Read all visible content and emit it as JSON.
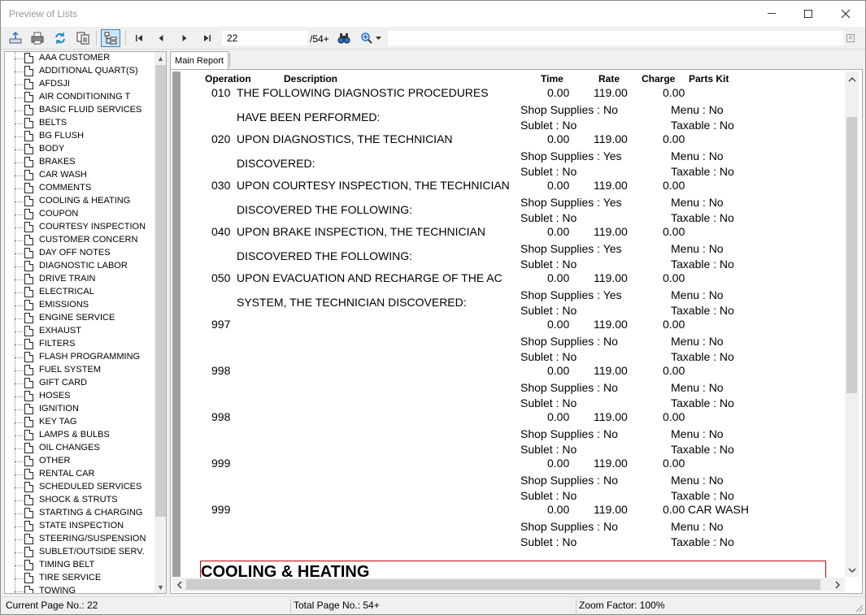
{
  "window": {
    "title": "Preview of Lists"
  },
  "toolbar": {
    "page_value": "22",
    "page_total": "/54+",
    "icons": [
      "export-icon",
      "print-icon",
      "refresh-icon",
      "copy-icon",
      "tree-view-icon",
      "first-page-icon",
      "prev-page-icon",
      "next-page-icon",
      "last-page-icon",
      "binoculars-icon",
      "zoom-icon"
    ]
  },
  "tree": {
    "items": [
      "AAA CUSTOMER",
      "ADDITIONAL QUART(S)",
      "AFDSJI",
      "AIR CONDITIONING T",
      "BASIC FLUID SERVICES",
      "BELTS",
      "BG FLUSH",
      "BODY",
      "BRAKES",
      "CAR WASH",
      "COMMENTS",
      "COOLING & HEATING",
      "COUPON",
      "COURTESY INSPECTION",
      "CUSTOMER CONCERN",
      "DAY OFF NOTES",
      "DIAGNOSTIC LABOR",
      "DRIVE TRAIN",
      "ELECTRICAL",
      "EMISSIONS",
      "ENGINE SERVICE",
      "EXHAUST",
      "FILTERS",
      "FLASH PROGRAMMING",
      "FUEL SYSTEM",
      "GIFT CARD",
      "HOSES",
      "IGNITION",
      "KEY TAG",
      "LAMPS & BULBS",
      "OIL CHANGES",
      "OTHER",
      "RENTAL CAR",
      "SCHEDULED SERVICES",
      "SHOCK & STRUTS",
      "STARTING & CHARGING",
      "STATE INSPECTION",
      "STEERING/SUSPENSION",
      "SUBLET/OUTSIDE SERV.",
      "TIMING BELT",
      "TIRE SERVICE",
      "TOWING"
    ]
  },
  "tabs": [
    {
      "label": "Main Report"
    }
  ],
  "report": {
    "headers": {
      "operation": "Operation",
      "description": "Description",
      "time": "Time",
      "rate": "Rate",
      "charge": "Charge",
      "parts_kit": "Parts Kit"
    },
    "rows": [
      {
        "op": "010",
        "desc1": "THE FOLLOWING DIAGNOSTIC PROCEDURES",
        "desc2": "HAVE BEEN PERFORMED:",
        "time": "0.00",
        "rate": "119.00",
        "charge": "0.00",
        "kit": "",
        "shop": "Shop Supplies : No",
        "menu": "Menu : No",
        "sublet": "Sublet : No",
        "taxable": "Taxable : No"
      },
      {
        "op": "020",
        "desc1": "UPON DIAGNOSTICS, THE TECHNICIAN",
        "desc2": "DISCOVERED:",
        "time": "0.00",
        "rate": "119.00",
        "charge": "0.00",
        "kit": "",
        "shop": "Shop Supplies : Yes",
        "menu": "Menu : No",
        "sublet": "Sublet : No",
        "taxable": "Taxable : No"
      },
      {
        "op": "030",
        "desc1": "UPON COURTESY INSPECTION, THE TECHNICIAN",
        "desc2": "DISCOVERED THE FOLLOWING:",
        "time": "0.00",
        "rate": "119.00",
        "charge": "0.00",
        "kit": "",
        "shop": "Shop Supplies : Yes",
        "menu": "Menu : No",
        "sublet": "Sublet : No",
        "taxable": "Taxable : No"
      },
      {
        "op": "040",
        "desc1": "UPON BRAKE INSPECTION, THE TECHNICIAN",
        "desc2": "DISCOVERED THE FOLLOWING:",
        "time": "0.00",
        "rate": "119.00",
        "charge": "0.00",
        "kit": "",
        "shop": "Shop Supplies : Yes",
        "menu": "Menu : No",
        "sublet": "Sublet : No",
        "taxable": "Taxable : No"
      },
      {
        "op": "050",
        "desc1": "UPON EVACUATION AND RECHARGE OF THE AC",
        "desc2": "SYSTEM, THE TECHNICIAN DISCOVERED:",
        "time": "0.00",
        "rate": "119.00",
        "charge": "0.00",
        "kit": "",
        "shop": "Shop Supplies : Yes",
        "menu": "Menu : No",
        "sublet": "Sublet : No",
        "taxable": "Taxable : No"
      },
      {
        "op": "997",
        "desc1": "",
        "desc2": "",
        "time": "0.00",
        "rate": "119.00",
        "charge": "0.00",
        "kit": "",
        "shop": "Shop Supplies : No",
        "menu": "Menu : No",
        "sublet": "Sublet : No",
        "taxable": "Taxable : No"
      },
      {
        "op": "998",
        "desc1": "",
        "desc2": "",
        "time": "0.00",
        "rate": "119.00",
        "charge": "0.00",
        "kit": "",
        "shop": "Shop Supplies : No",
        "menu": "Menu : No",
        "sublet": "Sublet : No",
        "taxable": "Taxable : No"
      },
      {
        "op": "998",
        "desc1": "",
        "desc2": "",
        "time": "0.00",
        "rate": "119.00",
        "charge": "0.00",
        "kit": "",
        "shop": "Shop Supplies : No",
        "menu": "Menu : No",
        "sublet": "Sublet : No",
        "taxable": "Taxable : No"
      },
      {
        "op": "999",
        "desc1": "",
        "desc2": "",
        "time": "0.00",
        "rate": "119.00",
        "charge": "0.00",
        "kit": "",
        "shop": "Shop Supplies : No",
        "menu": "Menu : No",
        "sublet": "Sublet : No",
        "taxable": "Taxable : No"
      },
      {
        "op": "999",
        "desc1": "",
        "desc2": "",
        "time": "0.00",
        "rate": "119.00",
        "charge": "0.00",
        "kit": "CAR WASH",
        "shop": "Shop Supplies : No",
        "menu": "Menu : No",
        "sublet": "Sublet : No",
        "taxable": "Taxable : No"
      }
    ],
    "next_section": "COOLING & HEATING"
  },
  "status": {
    "current_page": "Current Page No.: 22",
    "total_page": "Total Page No.: 54+",
    "zoom": "Zoom Factor: 100%"
  }
}
